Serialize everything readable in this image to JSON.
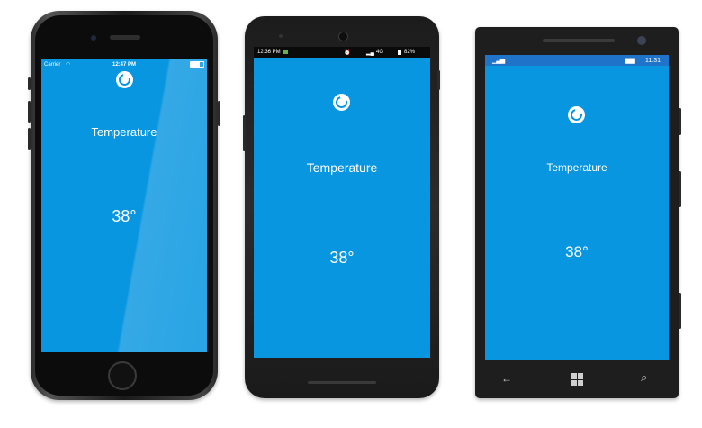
{
  "app": {
    "title": "Temperature",
    "value": "38°"
  },
  "iphone": {
    "status": {
      "carrier": "Carrier",
      "time": "12:47 PM"
    }
  },
  "android": {
    "status": {
      "time": "12:36 PM",
      "network": "4G",
      "battery": "82%"
    }
  },
  "winphone": {
    "status": {
      "time": "11:31"
    },
    "nav": {
      "back": "←",
      "search": "⌕"
    }
  },
  "colors": {
    "screen": "#0896e0",
    "bezel": "#0a0a0a",
    "accent": "#1f73c9"
  }
}
